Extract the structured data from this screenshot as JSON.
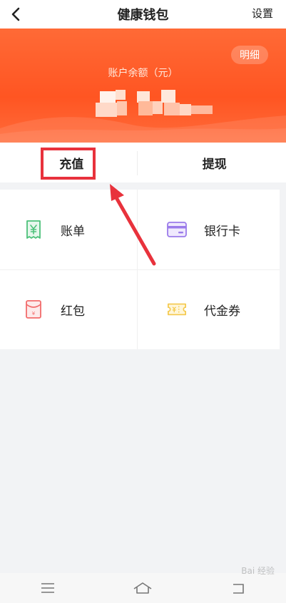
{
  "header": {
    "title": "健康钱包",
    "settings_label": "设置"
  },
  "banner": {
    "detail_label": "明细",
    "balance_label": "账户余额（元）",
    "accent_color": "#ff5a26"
  },
  "actions": {
    "recharge_label": "充值",
    "withdraw_label": "提现"
  },
  "grid": {
    "items": [
      {
        "label": "账单",
        "icon": "bill-icon",
        "color": "#4cc17a"
      },
      {
        "label": "银行卡",
        "icon": "bank-card-icon",
        "color": "#9b7bea"
      },
      {
        "label": "红包",
        "icon": "red-packet-icon",
        "color": "#f26b6b"
      },
      {
        "label": "代金券",
        "icon": "voucher-icon",
        "color": "#f4c84a"
      }
    ]
  },
  "annotation": {
    "highlight_color": "#e8323c"
  },
  "watermark": {
    "text": "Bai 经验"
  }
}
